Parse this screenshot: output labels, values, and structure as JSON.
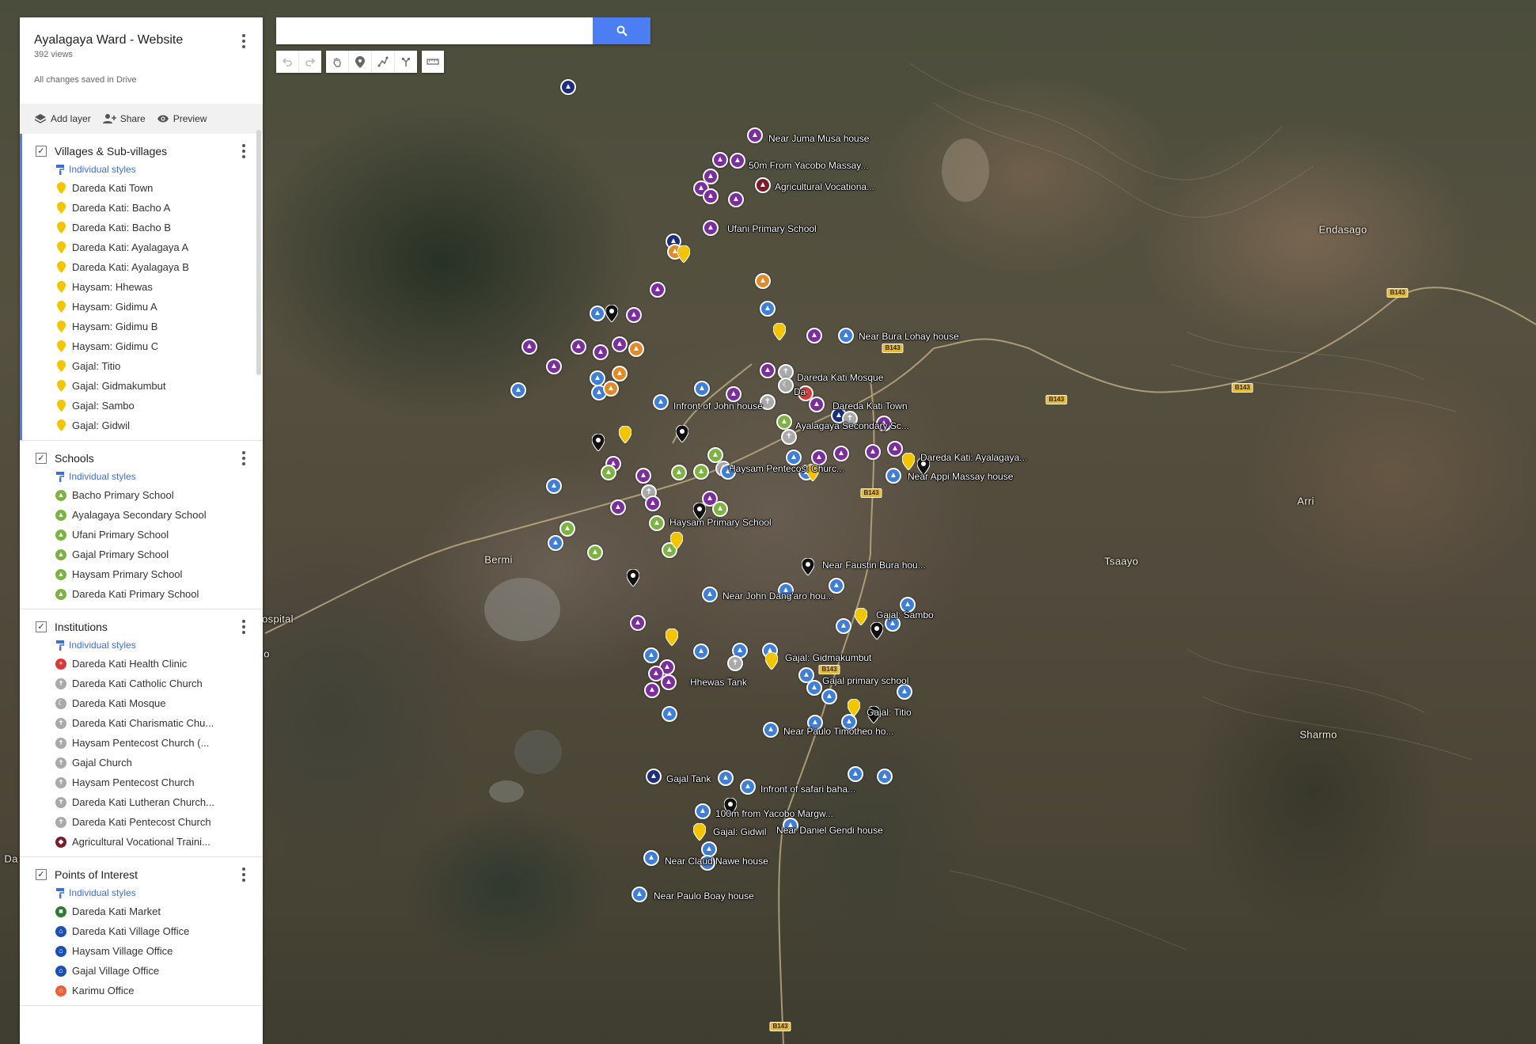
{
  "panel": {
    "title": "Ayalagaya Ward - Website",
    "views": "392 views",
    "status": "All changes saved in Drive",
    "actions": {
      "add_layer": "Add layer",
      "share": "Share",
      "preview": "Preview"
    }
  },
  "layers": [
    {
      "name": "Villages & Sub-villages",
      "styles": "Individual styles",
      "items": [
        {
          "label": "Dareda Kati Town",
          "icon": "yellow-pin-icon",
          "color": "#f2c500"
        },
        {
          "label": "Dareda Kati: Bacho A",
          "icon": "yellow-pin-icon",
          "color": "#f2c500"
        },
        {
          "label": "Dareda Kati: Bacho B",
          "icon": "yellow-pin-icon",
          "color": "#f2c500"
        },
        {
          "label": "Dareda Kati: Ayalagaya A",
          "icon": "yellow-pin-icon",
          "color": "#f2c500"
        },
        {
          "label": "Dareda Kati: Ayalagaya B",
          "icon": "yellow-pin-icon",
          "color": "#f2c500"
        },
        {
          "label": "Haysam: Hhewas",
          "icon": "yellow-pin-icon",
          "color": "#f2c500"
        },
        {
          "label": "Haysam: Gidimu A",
          "icon": "yellow-pin-icon",
          "color": "#f2c500"
        },
        {
          "label": "Haysam: Gidimu B",
          "icon": "yellow-pin-icon",
          "color": "#f2c500"
        },
        {
          "label": "Haysam: Gidimu C",
          "icon": "yellow-pin-icon",
          "color": "#f2c500"
        },
        {
          "label": "Gajal: Titio",
          "icon": "yellow-pin-icon",
          "color": "#f2c500"
        },
        {
          "label": "Gajal: Gidmakumbut",
          "icon": "yellow-pin-icon",
          "color": "#f2c500"
        },
        {
          "label": "Gajal: Sambo",
          "icon": "yellow-pin-icon",
          "color": "#f2c500"
        },
        {
          "label": "Gajal: Gidwil",
          "icon": "yellow-pin-icon",
          "color": "#f2c500"
        }
      ]
    },
    {
      "name": "Schools",
      "styles": "Individual styles",
      "items": [
        {
          "label": "Bacho Primary School",
          "icon": "school-icon",
          "color": "#7cb342"
        },
        {
          "label": "Ayalagaya Secondary School",
          "icon": "school-icon",
          "color": "#7cb342"
        },
        {
          "label": "Ufani Primary School",
          "icon": "school-icon",
          "color": "#7cb342"
        },
        {
          "label": "Gajal Primary School",
          "icon": "school-icon",
          "color": "#7cb342"
        },
        {
          "label": "Haysam Primary School",
          "icon": "school-icon",
          "color": "#7cb342"
        },
        {
          "label": "Dareda Kati Primary School",
          "icon": "school-icon",
          "color": "#7cb342"
        }
      ]
    },
    {
      "name": "Institutions",
      "styles": "Individual styles",
      "items": [
        {
          "label": "Dareda Kati Health Clinic",
          "icon": "health-cross-icon",
          "color": "#d33b3b"
        },
        {
          "label": "Dareda Kati Catholic Church",
          "icon": "church-cross-icon",
          "color": "#a9a9a9"
        },
        {
          "label": "Dareda Kati Mosque",
          "icon": "mosque-crescent-icon",
          "color": "#a9a9a9"
        },
        {
          "label": "Dareda Kati Charismatic Chu...",
          "icon": "church-cross-icon",
          "color": "#a9a9a9"
        },
        {
          "label": "Haysam Pentecost Church (...",
          "icon": "church-cross-icon",
          "color": "#a9a9a9"
        },
        {
          "label": "Gajal Church",
          "icon": "church-cross-icon",
          "color": "#a9a9a9"
        },
        {
          "label": "Haysam Pentecost Church",
          "icon": "church-cross-icon",
          "color": "#a9a9a9"
        },
        {
          "label": "Dareda Kati Lutheran Church...",
          "icon": "church-cross-icon",
          "color": "#a9a9a9"
        },
        {
          "label": "Dareda Kati Pentecost Church",
          "icon": "church-cross-icon",
          "color": "#a9a9a9"
        },
        {
          "label": "Agricultural Vocational Traini...",
          "icon": "graduation-cap-icon",
          "color": "#7a1d2a"
        }
      ]
    },
    {
      "name": "Points of Interest",
      "styles": "Individual styles",
      "items": [
        {
          "label": "Dareda Kati Market",
          "icon": "market-icon",
          "color": "#2e7d32"
        },
        {
          "label": "Dareda Kati Village Office",
          "icon": "office-icon",
          "color": "#1b4fb5"
        },
        {
          "label": "Haysam Village Office",
          "icon": "office-icon",
          "color": "#1b4fb5"
        },
        {
          "label": "Gajal Village Office",
          "icon": "office-icon",
          "color": "#1b4fb5"
        },
        {
          "label": "Karimu Office",
          "icon": "office-icon",
          "color": "#e8613b"
        }
      ]
    }
  ],
  "search": {
    "placeholder": "",
    "value": ""
  },
  "map": {
    "places": [
      "Endasago",
      "Arri",
      "Tsaayo",
      "Sharmo",
      "Bermi",
      "ospital",
      "Da",
      "o"
    ],
    "road_shields": [
      "B143",
      "B143",
      "B143",
      "B143",
      "B143",
      "B143",
      "B143"
    ],
    "marker_labels": [
      "Near Juma Musa house",
      "50m From Yacobo Massay...",
      "Agricultural Vocationa...",
      "Ufani Primary School",
      "Near Bura Lohay house",
      "Dareda Kati Mosque",
      "Dareda Kati Town",
      "Infront of John house",
      "Ayalagaya Secondary Sc...",
      "Dareda Kati: Ayalagaya...",
      "Near Appi Massay house",
      "Haysam Pentecost Churc...",
      "Haysam Primary School",
      "Near Faustin Bura hou...",
      "Near John Dang'aro hou...",
      "Gajal: Sambo",
      "Gajal: Gidmakumbut",
      "Hhewas Tank",
      "Gajal primary school",
      "Gajal: Titio",
      "Near Paulo Timotheo ho...",
      "Gajal Tank",
      "Infront of safari baha...",
      "100m from Yacobo Margw...",
      "Gajal: Gidwil",
      "Near Daniel Gendi house",
      "Near Claud Nawe house",
      "Near Paulo Boay house",
      "Da"
    ]
  }
}
